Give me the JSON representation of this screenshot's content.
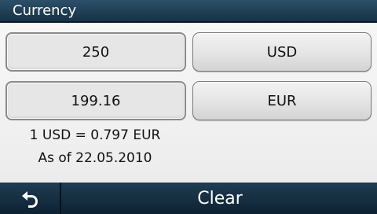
{
  "titlebar": {
    "title": "Currency"
  },
  "converter": {
    "amount": "250",
    "from_currency": "USD",
    "result": "199.16",
    "to_currency": "EUR",
    "rate_text": "1 USD = 0.797 EUR",
    "date_text": "As of 22.05.2010"
  },
  "bottombar": {
    "back_icon": "back-arrow-icon",
    "clear_label": "Clear"
  }
}
